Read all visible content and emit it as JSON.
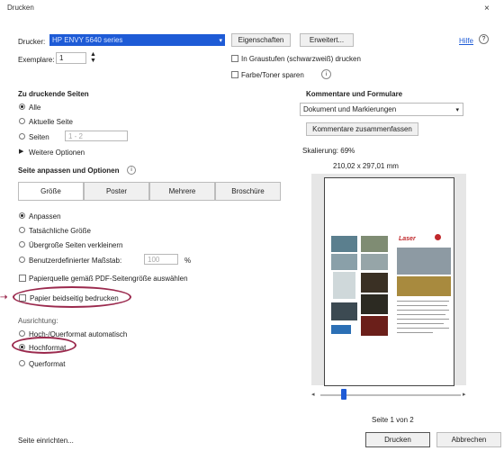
{
  "window": {
    "title": "Drucken",
    "close_glyph": "×"
  },
  "printer": {
    "label": "Drucker:",
    "selected": "HP ENVY 5640 series",
    "properties_button": "Eigenschaften",
    "advanced_button": "Erweitert...",
    "help_link": "Hilfe"
  },
  "copies": {
    "label": "Exemplare:",
    "value": "1"
  },
  "options": {
    "grayscale": "In Graustufen (schwarzweiß) drucken",
    "save_toner": "Farbe/Toner sparen"
  },
  "pages_to_print": {
    "heading": "Zu druckende Seiten",
    "all": "Alle",
    "current": "Aktuelle Seite",
    "pages": "Seiten",
    "pages_value": "1 - 2",
    "more_options": "Weitere Optionen"
  },
  "sizing": {
    "heading": "Seite anpassen und Optionen",
    "tabs": [
      "Größe",
      "Poster",
      "Mehrere",
      "Broschüre"
    ],
    "fit": "Anpassen",
    "actual": "Tatsächliche Größe",
    "shrink": "Übergroße Seiten verkleinern",
    "custom_scale": "Benutzerdefinierter Maßstab:",
    "custom_scale_value": "100",
    "percent": "%",
    "paper_source": "Papierquelle gemäß PDF-Seitengröße auswählen",
    "both_sides": "Papier beidseitig bedrucken"
  },
  "orientation": {
    "heading": "Ausrichtung:",
    "auto": "Hoch-/Querformat automatisch",
    "portrait": "Hochformat",
    "landscape": "Querformat"
  },
  "comments": {
    "heading": "Kommentare und Formulare",
    "selected": "Dokument und Markierungen",
    "summarize_button": "Kommentare zusammenfassen",
    "scaling": "Skalierung: 69%",
    "paper_size": "210,02 x 297,01 mm"
  },
  "preview": {
    "page_info": "Seite 1 von 2",
    "page_fraction": 0.5,
    "logo_text": "Laser"
  },
  "footer": {
    "page_setup": "Seite einrichten...",
    "print_button": "Drucken",
    "cancel_button": "Abbrechen"
  },
  "colors": {
    "annotation": "#9b2a4e",
    "accent": "#1e5bd6"
  }
}
